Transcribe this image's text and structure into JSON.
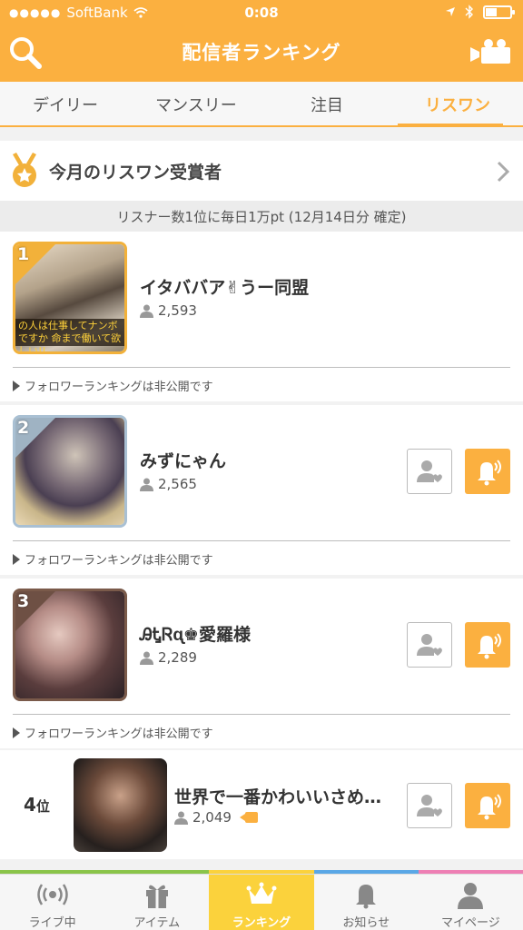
{
  "status": {
    "carrier": "SoftBank",
    "signal_dots": "●●●●●",
    "time": "0:08"
  },
  "header": {
    "title": "配信者ランキング",
    "search_icon": "search-icon",
    "video_icon": "video-camera-icon"
  },
  "tabs": [
    {
      "label": "デイリー",
      "active": false
    },
    {
      "label": "マンスリー",
      "active": false
    },
    {
      "label": "注目",
      "active": false
    },
    {
      "label": "リスワン",
      "active": true
    }
  ],
  "award": {
    "title": "今月のリスワン受賞者",
    "notice": "リスナー数1位に毎日1万pt (12月14日分 確定)"
  },
  "rankings": [
    {
      "rank": "1",
      "name": "イタババア✌うー同盟",
      "listeners": "2,593",
      "follow_note": "フォロワーランキングは非公開です",
      "caption": "の人は仕事してナンボですか 命まで働いて欲しい!!"
    },
    {
      "rank": "2",
      "name": "みずにゃん",
      "listeners": "2,565",
      "follow_note": "フォロワーランキングは非公開です"
    },
    {
      "rank": "3",
      "name": "ᎯᎿᏒᶐ♚愛羅様",
      "listeners": "2,289",
      "follow_note": "フォロワーランキングは非公開です"
    }
  ],
  "row4": {
    "rank": "4",
    "rank_suffix": "位",
    "name": "世界で一番かわいいさめ…",
    "listeners": "2,049"
  },
  "bottom_nav": [
    {
      "label": "ライブ中",
      "icon": "live-broadcast-icon"
    },
    {
      "label": "アイテム",
      "icon": "gift-icon"
    },
    {
      "label": "ランキング",
      "icon": "crown-icon"
    },
    {
      "label": "お知らせ",
      "icon": "bell-icon"
    },
    {
      "label": "マイページ",
      "icon": "person-icon"
    }
  ],
  "colors": {
    "accent": "#fbb040",
    "nav_active": "#fbd23c",
    "strip": [
      "#8ac44a",
      "#8ac44a",
      "#fbd23c",
      "#5aa7e6",
      "#ee7fb4"
    ]
  }
}
